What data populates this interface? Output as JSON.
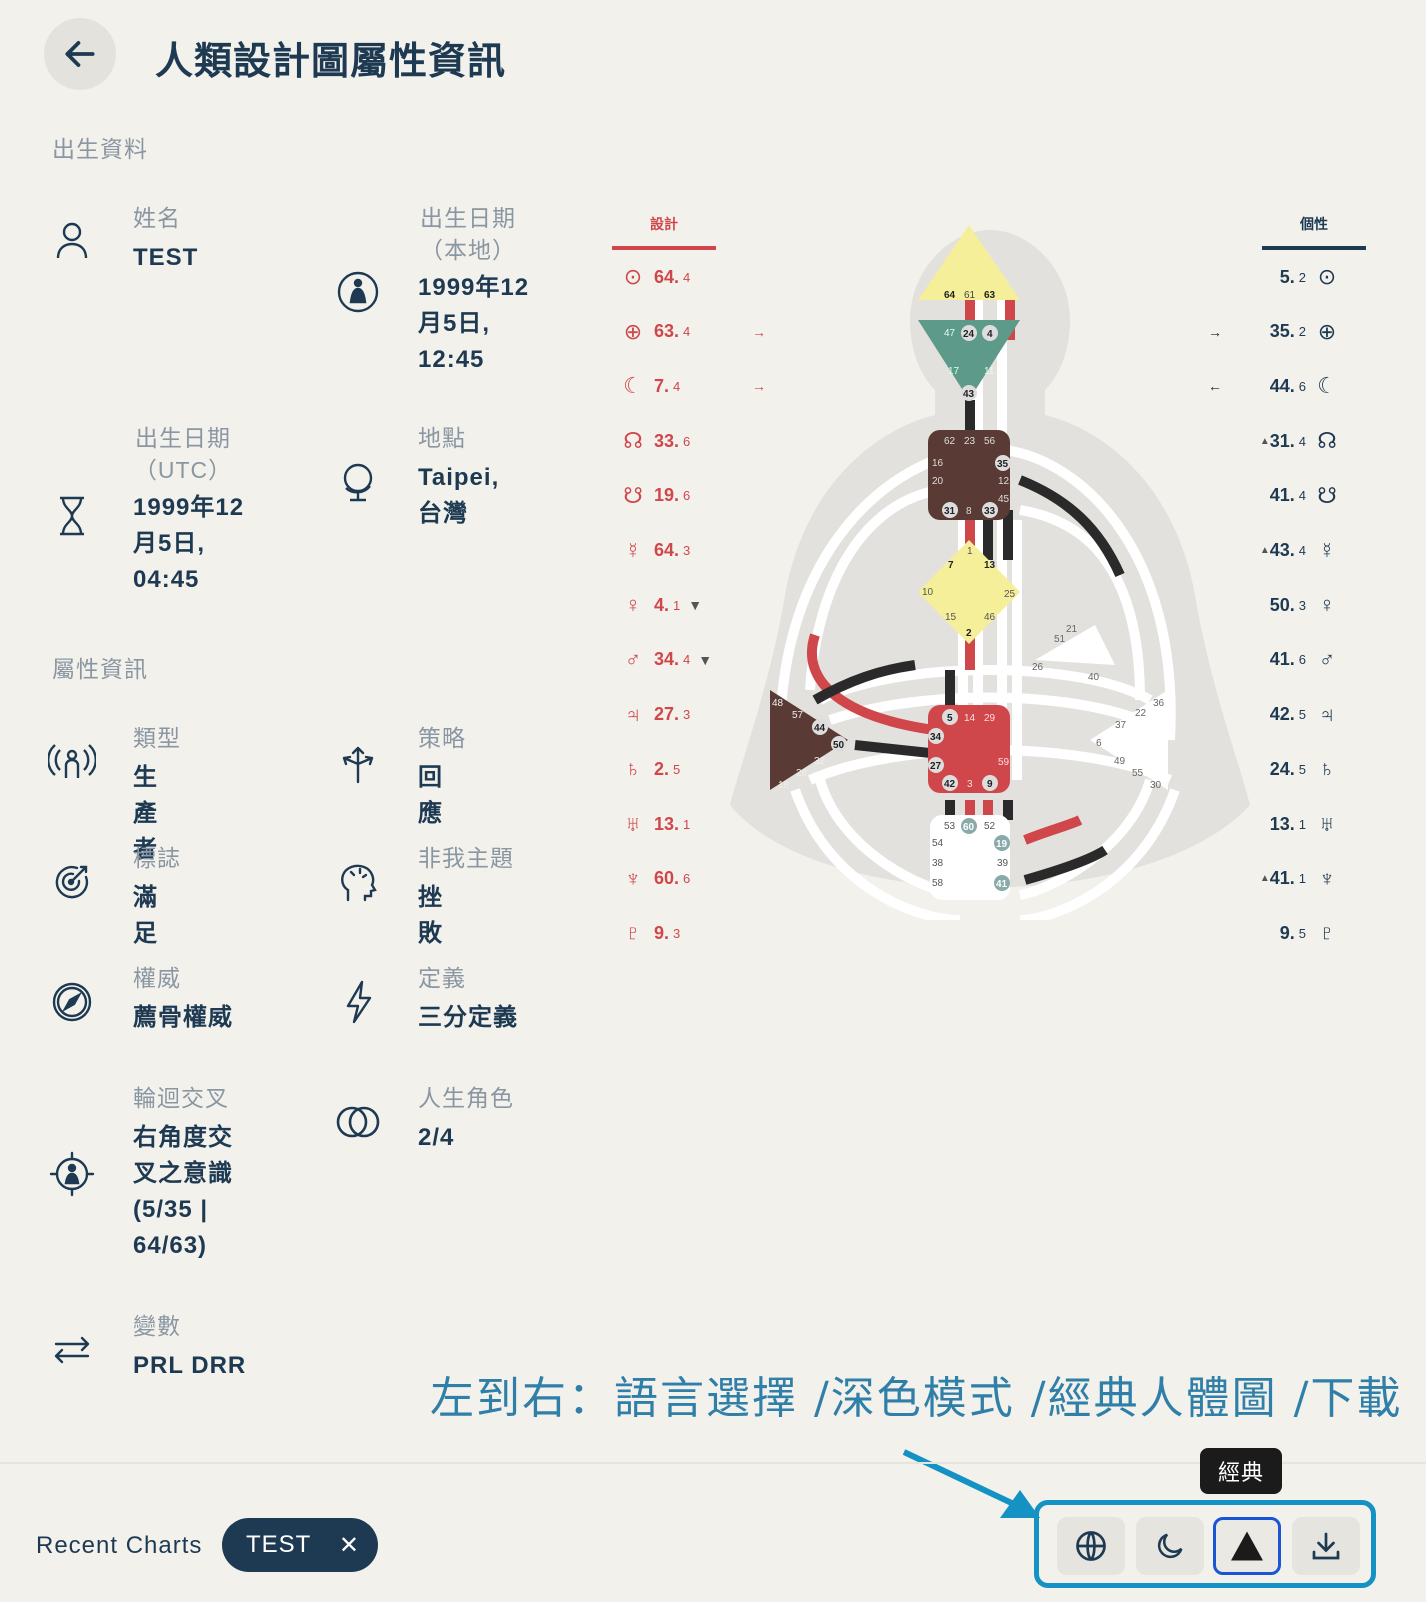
{
  "header": {
    "title": "人類設計圖屬性資訊"
  },
  "sections": {
    "birth": "出生資料",
    "attributes": "屬性資訊"
  },
  "birth": {
    "name_label": "姓名",
    "name_value": "TEST",
    "date_local_label": "出生日期（本地）",
    "date_local_value": "1999年12月5日, 12:45",
    "date_utc_label": "出生日期（UTC）",
    "date_utc_value": "1999年12月5日, 04:45",
    "place_label": "地點",
    "place_value": "Taipei, 台灣"
  },
  "attributes": {
    "type_label": "類型",
    "type_value": "生產者",
    "strategy_label": "策略",
    "strategy_value": "回應",
    "signature_label": "標誌",
    "signature_value": "滿足",
    "notself_label": "非我主題",
    "notself_value": "挫敗",
    "authority_label": "權威",
    "authority_value": "薦骨權威",
    "definition_label": "定義",
    "definition_value": "三分定義",
    "cross_label": "輪迴交叉",
    "cross_value": "右角度交叉之意識 (5/35 | 64/63)",
    "profile_label": "人生角色",
    "profile_value": "2/4",
    "variable_label": "變數",
    "variable_value": "PRL DRR"
  },
  "chart": {
    "design_header": "設計",
    "personality_header": "個性",
    "design_color": "#d0474b",
    "personality_color": "#1e3a52",
    "design": [
      {
        "sym": "⊙",
        "gate": "64.",
        "line": "4",
        "mark": ""
      },
      {
        "sym": "⊕",
        "gate": "63.",
        "line": "4",
        "mark": "→"
      },
      {
        "sym": "☾",
        "gate": "7.",
        "line": "4",
        "mark": "→"
      },
      {
        "sym": "☊",
        "gate": "33.",
        "line": "6",
        "mark": ""
      },
      {
        "sym": "☋",
        "gate": "19.",
        "line": "6",
        "mark": ""
      },
      {
        "sym": "☿",
        "gate": "64.",
        "line": "3",
        "mark": ""
      },
      {
        "sym": "♀",
        "gate": "4.",
        "line": "1",
        "mark": "▼"
      },
      {
        "sym": "♂",
        "gate": "34.",
        "line": "4",
        "mark": "▼"
      },
      {
        "sym": "♃",
        "gate": "27.",
        "line": "3",
        "mark": ""
      },
      {
        "sym": "♄",
        "gate": "2.",
        "line": "5",
        "mark": ""
      },
      {
        "sym": "♅",
        "gate": "13.",
        "line": "1",
        "mark": ""
      },
      {
        "sym": "♆",
        "gate": "60.",
        "line": "6",
        "mark": ""
      },
      {
        "sym": "♇",
        "gate": "9.",
        "line": "3",
        "mark": ""
      }
    ],
    "personality": [
      {
        "sym": "⊙",
        "gate": "5.",
        "line": "2",
        "mark": ""
      },
      {
        "sym": "⊕",
        "gate": "35.",
        "line": "2",
        "mark": "→"
      },
      {
        "sym": "☾",
        "gate": "44.",
        "line": "6",
        "mark": "←"
      },
      {
        "sym": "☊",
        "gate": "31.",
        "line": "4",
        "mark": "▲"
      },
      {
        "sym": "☋",
        "gate": "41.",
        "line": "4",
        "mark": ""
      },
      {
        "sym": "☿",
        "gate": "43.",
        "line": "4",
        "mark": "▲"
      },
      {
        "sym": "♀",
        "gate": "50.",
        "line": "3",
        "mark": ""
      },
      {
        "sym": "♂",
        "gate": "41.",
        "line": "6",
        "mark": ""
      },
      {
        "sym": "♃",
        "gate": "42.",
        "line": "5",
        "mark": ""
      },
      {
        "sym": "♄",
        "gate": "24.",
        "line": "5",
        "mark": ""
      },
      {
        "sym": "♅",
        "gate": "13.",
        "line": "1",
        "mark": ""
      },
      {
        "sym": "♆",
        "gate": "41.",
        "line": "1",
        "mark": "▲"
      },
      {
        "sym": "♇",
        "gate": "9.",
        "line": "5",
        "mark": ""
      }
    ],
    "gates": {
      "head": [
        "64",
        "61",
        "63"
      ],
      "ajna": [
        "47",
        "24",
        "4",
        "17",
        "11",
        "43"
      ],
      "throat": [
        "62",
        "23",
        "56",
        "16",
        "35",
        "20",
        "12",
        "45",
        "31",
        "8",
        "33"
      ],
      "g": [
        "1",
        "7",
        "13",
        "10",
        "25",
        "15",
        "46",
        "2"
      ],
      "ego": [
        "21",
        "51",
        "26",
        "40"
      ],
      "sacral": [
        "5",
        "14",
        "29",
        "34",
        "27",
        "59",
        "42",
        "3",
        "9"
      ],
      "spleen": [
        "48",
        "57",
        "44",
        "50",
        "32",
        "28",
        "18"
      ],
      "solar": [
        "36",
        "22",
        "37",
        "6",
        "49",
        "55",
        "30"
      ],
      "root": [
        "53",
        "60",
        "52",
        "54",
        "19",
        "38",
        "39",
        "58",
        "41"
      ]
    }
  },
  "annotation": "左到右：語言選擇 /深色模式 /經典人體圖 /下載",
  "footer": {
    "recent_label": "Recent Charts",
    "recent_chip": "TEST",
    "tooltip": "經典",
    "toolbar_icons": [
      "globe-icon",
      "moon-icon",
      "triangle-icon",
      "download-icon"
    ]
  }
}
